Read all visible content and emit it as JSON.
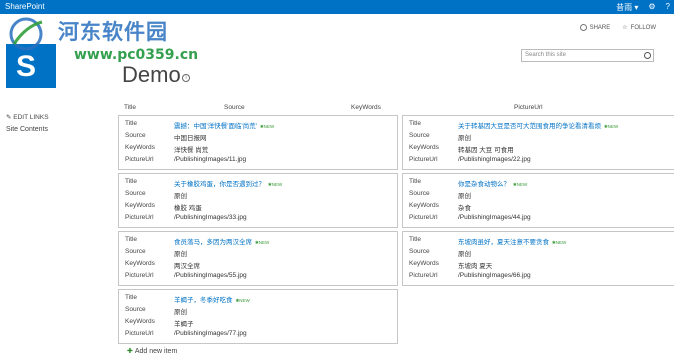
{
  "suite": {
    "brand": "SharePoint",
    "user": "昔雨 ▾",
    "gear": "⚙",
    "help": "?"
  },
  "actions": {
    "share": "SHARE",
    "follow": "FOLLOW"
  },
  "watermark": {
    "line1": "河东软件园",
    "line2": "www.pc0359.cn"
  },
  "site": {
    "title": "Demo"
  },
  "search": {
    "placeholder": "Search this site"
  },
  "nav": {
    "edit_links": "EDIT LINKS",
    "site_contents": "Site Contents"
  },
  "columns": [
    "Title",
    "Source",
    "KeyWords",
    "PictureUrl"
  ],
  "field_labels": {
    "title": "Title",
    "source": "Source",
    "keywords": "KeyWords",
    "pictureurl": "PictureUrl"
  },
  "new_badge": "✱NEW",
  "items": [
    {
      "title": "震撼：中国'洋快餐'面临'尚荒'",
      "source": "中国日报网",
      "keywords": "洋快餐 尚荒",
      "pictureurl": "/PublishingImages/11.jpg"
    },
    {
      "title": "关于转基因大豆是否可大范围食用的争论看清看烦",
      "source": "原创",
      "keywords": "转基因 大豆 可食用",
      "pictureurl": "/PublishingImages/22.jpg"
    },
    {
      "title": "关于橡胶鸡蛋，你是否遇到过？",
      "source": "原创",
      "keywords": "橡胶 鸡蛋",
      "pictureurl": "/PublishingImages/33.jpg"
    },
    {
      "title": "你是杂食动物么？",
      "source": "原创",
      "keywords": "杂食",
      "pictureurl": "/PublishingImages/44.jpg"
    },
    {
      "title": "食员落马，多因为两汉全席",
      "source": "原创",
      "keywords": "两汉全席",
      "pictureurl": "/PublishingImages/55.jpg"
    },
    {
      "title": "东坡肉虽好，夏天注意不要贪食",
      "source": "原创",
      "keywords": "东坡肉 夏天",
      "pictureurl": "/PublishingImages/66.jpg"
    },
    {
      "title": "羊蝎子，冬季好吃食",
      "source": "原创",
      "keywords": "羊蝎子",
      "pictureurl": "/PublishingImages/77.jpg"
    }
  ],
  "add_new": "Add new item"
}
